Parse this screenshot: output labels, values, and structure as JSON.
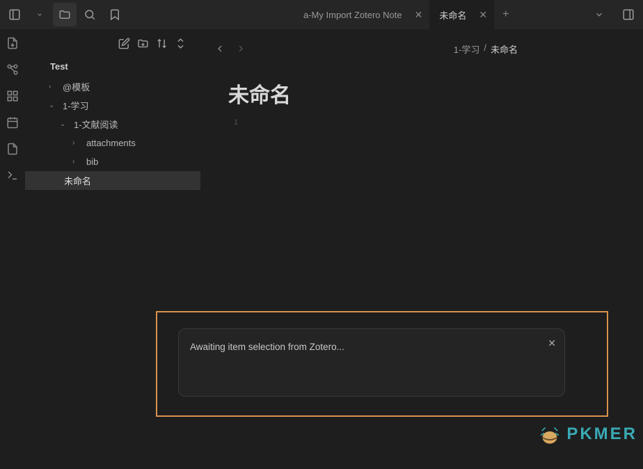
{
  "tabs": [
    {
      "label": "a-My Import Zotero Note",
      "active": false
    },
    {
      "label": "未命名",
      "active": true
    }
  ],
  "sidebar": {
    "vault_name": "Test",
    "items": [
      {
        "label": "@模板",
        "chev": "›",
        "indent": 1
      },
      {
        "label": "1-学习",
        "chev": "⌄",
        "indent": 1
      },
      {
        "label": "1-文献阅读",
        "chev": "⌄",
        "indent": 2
      },
      {
        "label": "attachments",
        "chev": "›",
        "indent": 3
      },
      {
        "label": "bib",
        "chev": "›",
        "indent": 3
      },
      {
        "label": "未命名",
        "chev": "",
        "indent": 3,
        "active": true
      }
    ]
  },
  "breadcrumb": {
    "parent": "1-学习",
    "sep": "/",
    "current": "未命名"
  },
  "note": {
    "title": "未命名",
    "line_num": "1"
  },
  "modal": {
    "message": "Awaiting item selection from Zotero..."
  },
  "watermark": {
    "text": "PKMER"
  }
}
